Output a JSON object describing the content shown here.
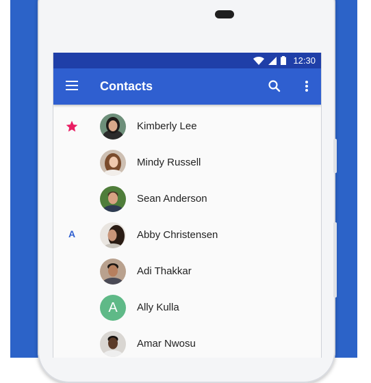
{
  "status_bar": {
    "time": "12:30",
    "icons": [
      "wifi-icon",
      "signal-icon",
      "battery-icon"
    ]
  },
  "app_bar": {
    "title": "Contacts",
    "icons": [
      "menu-icon",
      "search-icon",
      "more-vert-icon"
    ]
  },
  "colors": {
    "background": "#2c63c8",
    "status_bar": "#1f3fa8",
    "app_bar": "#2f5fd0",
    "star": "#e91e63",
    "avatar_green": "#5fb987"
  },
  "contacts": [
    {
      "name": "Kimberly Lee",
      "section": "star",
      "avatar": "photo"
    },
    {
      "name": "Mindy Russell",
      "section": "",
      "avatar": "photo"
    },
    {
      "name": "Sean Anderson",
      "section": "",
      "avatar": "photo"
    },
    {
      "name": "Abby Christensen",
      "section": "A",
      "avatar": "photo"
    },
    {
      "name": "Adi Thakkar",
      "section": "",
      "avatar": "photo"
    },
    {
      "name": "Ally Kulla",
      "section": "",
      "avatar": "A"
    },
    {
      "name": "Amar Nwosu",
      "section": "",
      "avatar": "photo"
    }
  ]
}
